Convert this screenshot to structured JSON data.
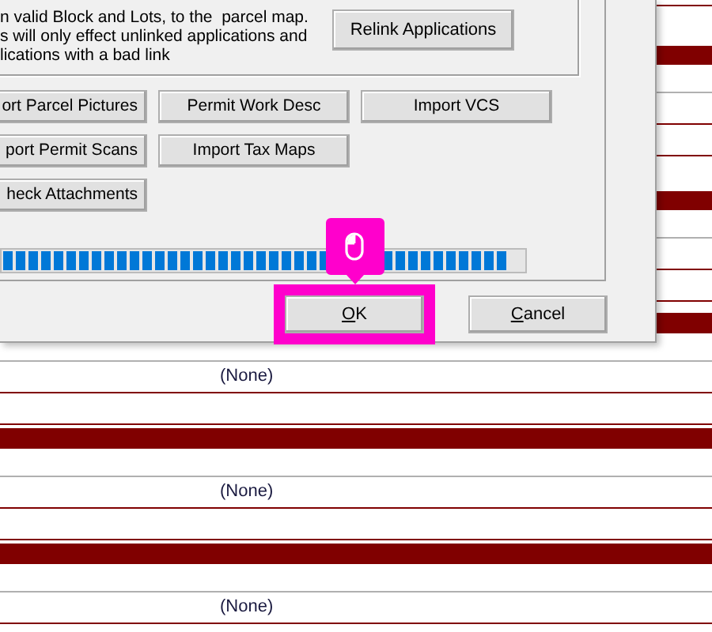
{
  "background_list": {
    "records": [
      {
        "value": "(None)"
      },
      {
        "value": "(None)"
      },
      {
        "value": "(None)"
      }
    ]
  },
  "dialog": {
    "description": [
      "n valid Block and Lots, to the  parcel map.",
      "s will only effect unlinked applications and",
      "lications with a bad link"
    ],
    "relink_button": "Relink Applications",
    "import_buttons": [
      {
        "label": "ort Parcel Pictures",
        "kind": "cut"
      },
      {
        "label": "Permit Work Desc",
        "kind": "full"
      },
      {
        "label": "Import VCS",
        "kind": "full"
      },
      {
        "label": "port Permit Scans",
        "kind": "cut"
      },
      {
        "label": "Import Tax Maps",
        "kind": "full"
      },
      {
        "label": "heck Attachments",
        "kind": "cut"
      }
    ],
    "progress": {
      "level": 1
    },
    "buttons": [
      {
        "label": "OK",
        "highlighted": true
      },
      {
        "label": "Cancel",
        "highlighted": false
      }
    ]
  }
}
